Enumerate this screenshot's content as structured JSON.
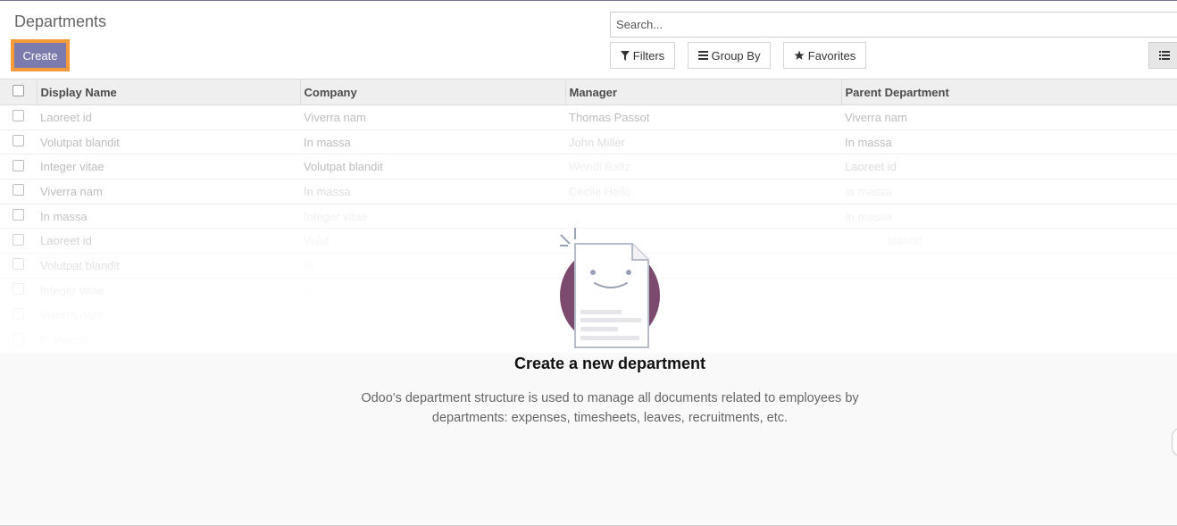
{
  "header": {
    "title": "Departments",
    "create_label": "Create",
    "search_placeholder": "Search...",
    "filters_label": "Filters",
    "groupby_label": "Group By",
    "favorites_label": "Favorites"
  },
  "table": {
    "columns": [
      "Display Name",
      "Company",
      "Manager",
      "Parent Department"
    ],
    "rows": [
      [
        "Laoreet id",
        "Viverra nam",
        "Thomas Passot",
        "Viverra nam"
      ],
      [
        "Volutpat blandit",
        "In massa",
        "John Miller",
        "In massa"
      ],
      [
        "Integer vitae",
        "Volutpat blandit",
        "Wendi Baltz",
        "Laoreet id"
      ],
      [
        "Viverra nam",
        "In massa",
        "Cécile Hello",
        "In massa"
      ],
      [
        "In massa",
        "Integer vitae",
        "",
        "In massa"
      ],
      [
        "Laoreet id",
        "Volut",
        "",
        "blandit"
      ],
      [
        "Volutpat blandit",
        "In",
        "",
        ""
      ],
      [
        "Integer vitae",
        "Vi",
        "",
        ""
      ],
      [
        "Viverra nam",
        "Vo",
        "",
        ""
      ],
      [
        "In massa",
        "Lo",
        "",
        ""
      ]
    ]
  },
  "empty_state": {
    "title": "Create a new department",
    "description_line1": "Odoo's department structure is used to manage all documents related to employees by",
    "description_line2": "departments: expenses, timesheets, leaves, recruitments, etc."
  },
  "colors": {
    "primary": "#7c7bad",
    "highlight_border": "#f59a3a",
    "illustration_circle": "#7b4a6e"
  },
  "icons": {
    "filters": "filter-icon",
    "groupby": "bars-icon",
    "favorites": "star-icon",
    "listview": "list-icon"
  }
}
